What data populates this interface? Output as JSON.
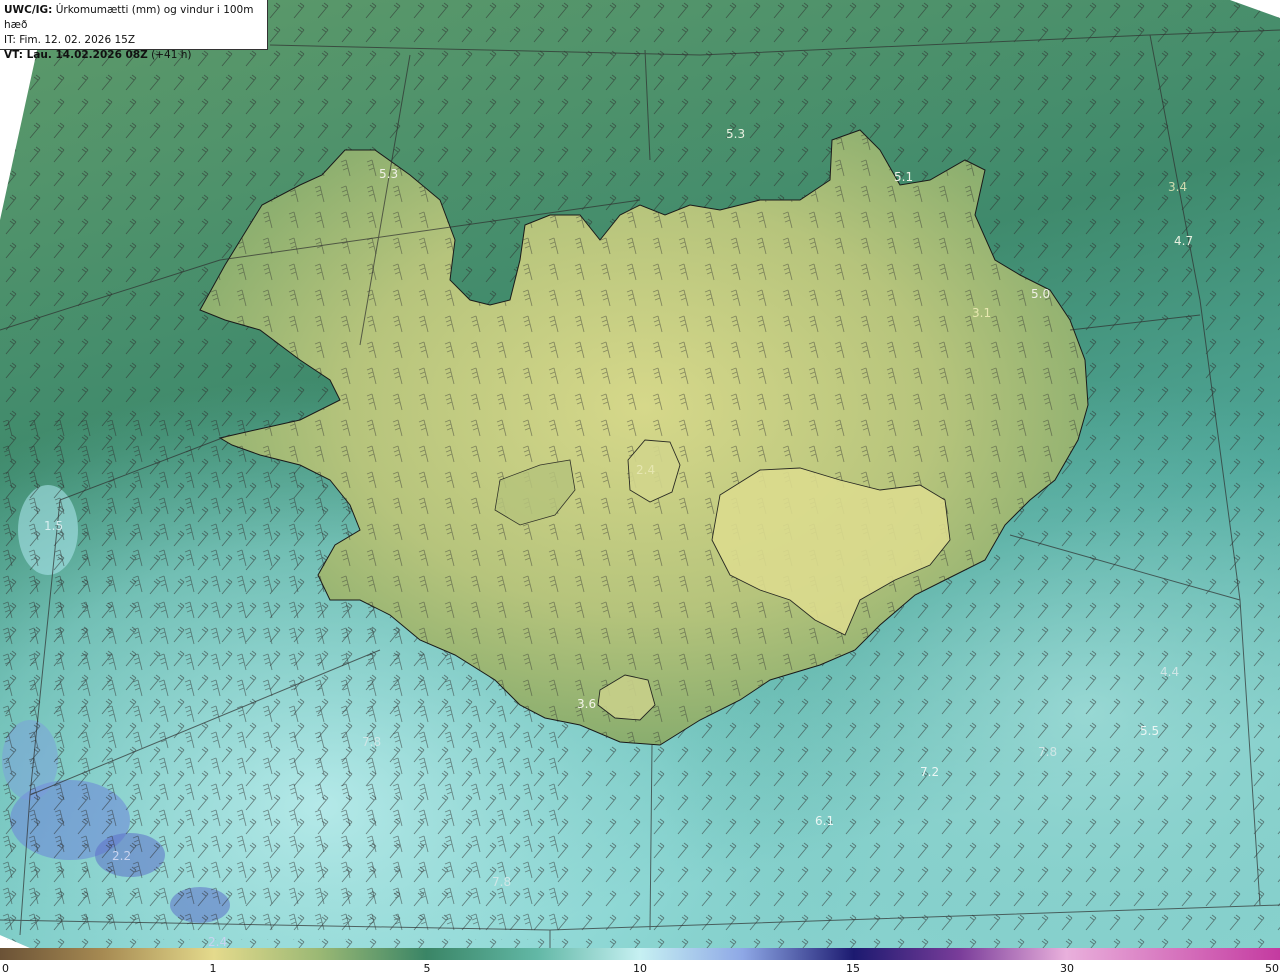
{
  "header": {
    "model": "UWC/IG:",
    "title": "Úrkomumætti (mm) og vindur i 100m hæð",
    "it_line": "IT: Fim. 12. 02. 2026 15Z",
    "vt_label": "VT: Lau. 14.02.2026 08Z",
    "vt_offset": "(+41 h)"
  },
  "colorbar": {
    "ticks": [
      "0",
      "1",
      "5",
      "10",
      "15",
      "30",
      "50"
    ],
    "colors": [
      "#6b5236",
      "#c9b05e",
      "#e0d98a",
      "#7aa36b",
      "#2f7a63",
      "#9ee5e6",
      "#cfeef5",
      "#4b5fc0",
      "#1c1a70",
      "#8a3d9a",
      "#e79bd6",
      "#c43aa0"
    ]
  },
  "map": {
    "value_labels": [
      {
        "text": "5.3"
      },
      {
        "text": "5.3"
      },
      {
        "text": "5.1"
      },
      {
        "text": "3.4"
      },
      {
        "text": "4.7"
      },
      {
        "text": "5.0"
      },
      {
        "text": "3.1"
      },
      {
        "text": "2.4"
      },
      {
        "text": "1.5"
      },
      {
        "text": "3.6"
      },
      {
        "text": "4.4"
      },
      {
        "text": "5.5"
      },
      {
        "text": "7.8"
      },
      {
        "text": "7.2"
      },
      {
        "text": "6.1"
      },
      {
        "text": "7.8"
      },
      {
        "text": "7.8"
      },
      {
        "text": "2.2"
      },
      {
        "text": "2.4"
      }
    ]
  }
}
